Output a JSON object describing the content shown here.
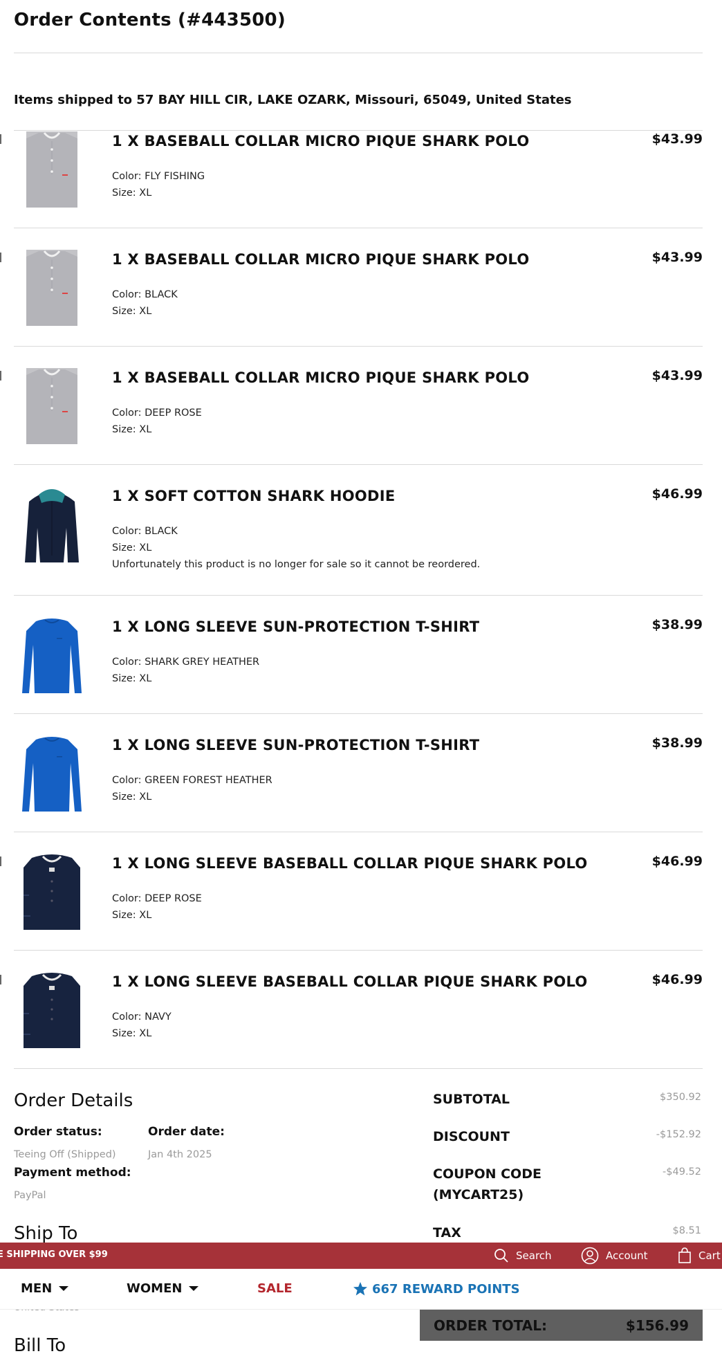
{
  "page": {
    "title": "Order Contents (#443500)",
    "shipped_to": "Items shipped to 57 BAY HILL CIR, LAKE OZARK, Missouri, 65049, United States"
  },
  "items": [
    {
      "name": "1 X BASEBALL COLLAR MICRO PIQUE SHARK POLO",
      "price": "$43.99",
      "color": "Color: FLY FISHING",
      "size": "Size: XL",
      "note": "",
      "image": "grey-polo"
    },
    {
      "name": "1 X BASEBALL COLLAR MICRO PIQUE SHARK POLO",
      "price": "$43.99",
      "color": "Color: BLACK",
      "size": "Size: XL",
      "note": "",
      "image": "grey-polo"
    },
    {
      "name": "1 X BASEBALL COLLAR MICRO PIQUE SHARK POLO",
      "price": "$43.99",
      "color": "Color: DEEP ROSE",
      "size": "Size: XL",
      "note": "",
      "image": "grey-polo"
    },
    {
      "name": "1 X SOFT COTTON SHARK HOODIE",
      "price": "$46.99",
      "color": "Color: BLACK",
      "size": "Size: XL",
      "note": "Unfortunately this product is no longer for sale so it cannot be reordered.",
      "image": "navy-hoodie"
    },
    {
      "name": "1 X LONG SLEEVE SUN-PROTECTION T-SHIRT",
      "price": "$38.99",
      "color": "Color: SHARK GREY HEATHER",
      "size": "Size: XL",
      "note": "",
      "image": "blue-longsleeve"
    },
    {
      "name": "1 X LONG SLEEVE SUN-PROTECTION T-SHIRT",
      "price": "$38.99",
      "color": "Color: GREEN FOREST HEATHER",
      "size": "Size: XL",
      "note": "",
      "image": "blue-longsleeve"
    },
    {
      "name": "1 X LONG SLEEVE BASEBALL COLLAR PIQUE SHARK POLO",
      "price": "$46.99",
      "color": "Color: DEEP ROSE",
      "size": "Size: XL",
      "note": "",
      "image": "navy-longsleeve-polo"
    },
    {
      "name": "1 X LONG SLEEVE BASEBALL COLLAR PIQUE SHARK POLO",
      "price": "$46.99",
      "color": "Color: NAVY",
      "size": "Size: XL",
      "note": "",
      "image": "navy-longsleeve-polo"
    }
  ],
  "order_details": {
    "heading": "Order Details",
    "status_label": "Order status:",
    "status_value": "Teeing Off (Shipped)",
    "date_label": "Order date:",
    "date_value": "Jan 4th 2025",
    "payment_label": "Payment method:",
    "payment_value": "PayPal",
    "ship_to_heading": "Ship To",
    "ship_to_country_partial": "United States",
    "bill_to_heading": "Bill To"
  },
  "summary": {
    "subtotal_label": "SUBTOTAL",
    "subtotal_value": "$350.92",
    "discount_label": "DISCOUNT",
    "discount_value": "-$152.92",
    "coupon_label_line1": "COUPON CODE",
    "coupon_label_line2": "(MYCART25)",
    "coupon_value": "-$49.52",
    "tax_label": "TAX",
    "tax_value": "$8.51",
    "total_label": "ORDER TOTAL:",
    "total_value": "$156.99"
  },
  "promo_bar": {
    "shipping_text": "E SHIPPING OVER $99",
    "search_label": "Search",
    "account_label": "Account",
    "cart_label": "Cart",
    "background": "#a63239"
  },
  "nav": {
    "men": "MEN",
    "women": "WOMEN",
    "sale": "SALE",
    "rewards": "667 REWARD POINTS",
    "sale_color": "#b3262d",
    "rewards_color": "#1a73b5"
  },
  "icons": [
    "search-icon",
    "account-icon",
    "cart-icon",
    "star-icon",
    "chevron-down-icon"
  ]
}
